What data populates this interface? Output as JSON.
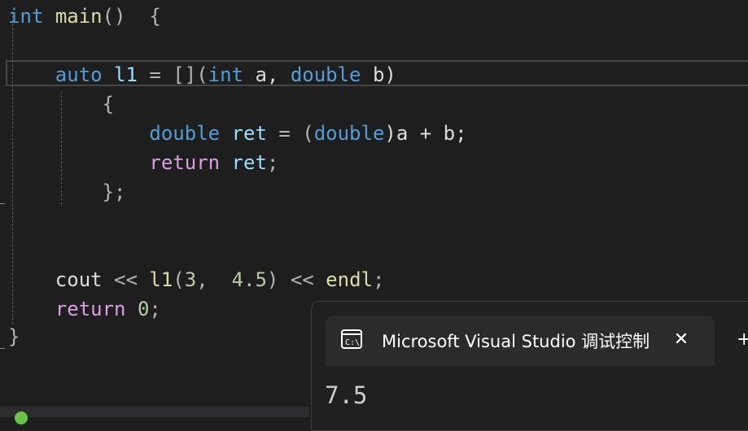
{
  "editor": {
    "lines": [
      {
        "tokens": [
          {
            "t": "int",
            "c": "kw"
          },
          {
            "t": " ",
            "c": "plain"
          },
          {
            "t": "main",
            "c": "fn"
          },
          {
            "t": "()  {",
            "c": "punct"
          }
        ]
      },
      {
        "tokens": []
      },
      {
        "tokens": [
          {
            "t": "    ",
            "c": "plain"
          },
          {
            "t": "auto",
            "c": "kw"
          },
          {
            "t": " ",
            "c": "plain"
          },
          {
            "t": "l1",
            "c": "var"
          },
          {
            "t": " = [](",
            "c": "op"
          },
          {
            "t": "int",
            "c": "kw"
          },
          {
            "t": " a, ",
            "c": "plain"
          },
          {
            "t": "double",
            "c": "kw"
          },
          {
            "t": " b)",
            "c": "plain"
          }
        ]
      },
      {
        "tokens": [
          {
            "t": "        {",
            "c": "punct"
          }
        ]
      },
      {
        "tokens": [
          {
            "t": "            ",
            "c": "plain"
          },
          {
            "t": "double",
            "c": "kw"
          },
          {
            "t": " ",
            "c": "plain"
          },
          {
            "t": "ret",
            "c": "var"
          },
          {
            "t": " = (",
            "c": "op"
          },
          {
            "t": "double",
            "c": "kw"
          },
          {
            "t": ")a + b;",
            "c": "plain"
          }
        ]
      },
      {
        "tokens": [
          {
            "t": "            ",
            "c": "plain"
          },
          {
            "t": "return",
            "c": "ctrl"
          },
          {
            "t": " ",
            "c": "plain"
          },
          {
            "t": "ret",
            "c": "var"
          },
          {
            "t": ";",
            "c": "punct"
          }
        ]
      },
      {
        "tokens": [
          {
            "t": "        };",
            "c": "punct"
          }
        ]
      },
      {
        "tokens": []
      },
      {
        "tokens": []
      },
      {
        "tokens": [
          {
            "t": "    ",
            "c": "plain"
          },
          {
            "t": "cout",
            "c": "plain"
          },
          {
            "t": " << ",
            "c": "op"
          },
          {
            "t": "l1",
            "c": "fn"
          },
          {
            "t": "(",
            "c": "punct"
          },
          {
            "t": "3",
            "c": "num"
          },
          {
            "t": ",  ",
            "c": "punct"
          },
          {
            "t": "4.5",
            "c": "num"
          },
          {
            "t": ") << ",
            "c": "op"
          },
          {
            "t": "endl",
            "c": "fn"
          },
          {
            "t": ";",
            "c": "punct"
          }
        ]
      },
      {
        "tokens": [
          {
            "t": "    ",
            "c": "plain"
          },
          {
            "t": "return",
            "c": "ctrl"
          },
          {
            "t": " ",
            "c": "plain"
          },
          {
            "t": "0",
            "c": "num"
          },
          {
            "t": ";",
            "c": "punct"
          }
        ]
      },
      {
        "tokens": [
          {
            "t": "}",
            "c": "punct"
          }
        ]
      }
    ]
  },
  "console": {
    "title": "Microsoft Visual Studio 调试控制台",
    "close_glyph": "✕",
    "newtab_glyph": "+",
    "icon": "console-icon",
    "output": "7.5"
  },
  "colors": {
    "editor_bg": "#1e1e1e",
    "keyword": "#569cd6",
    "control_keyword": "#d8a0df",
    "function": "#dcdcaa",
    "variable": "#9cdcfe",
    "number": "#b5cea8"
  }
}
